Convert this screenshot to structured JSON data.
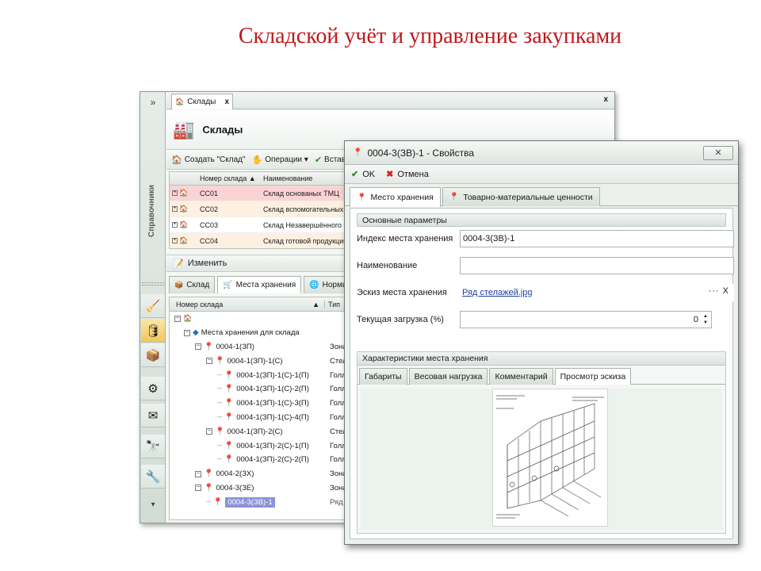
{
  "slide": {
    "title": "Складской учёт и управление закупками"
  },
  "back_window": {
    "sidebar": {
      "collapse_glyph": "»",
      "vertical_label": "Справочники",
      "more_glyph": "▾"
    },
    "doc_tab": {
      "label": "Склады",
      "close": "x"
    },
    "window_close": "x",
    "header": {
      "title": "Склады"
    },
    "toolbar": {
      "create": "Создать \"Склад\"",
      "operations": "Операции ▾",
      "insert": "Вставт"
    },
    "grid": {
      "columns": [
        "Номер склада ▲",
        "Наименование"
      ],
      "rows": [
        {
          "code": "СС01",
          "name": "Склад основаных ТМЦ"
        },
        {
          "code": "СС02",
          "name": "Склад вспомогательных"
        },
        {
          "code": "СС03",
          "name": "Склад Незавершённого п"
        },
        {
          "code": "СС04",
          "name": "Склад готовой продукции"
        }
      ]
    },
    "edit_label": "Изменить",
    "subtabs": [
      "Склад",
      "Места хранения",
      "Нормы за"
    ],
    "tree": {
      "columns": [
        "Номер склада",
        "▲",
        "Тип"
      ],
      "root_label": "Места хранения для склада",
      "rows": [
        {
          "label": "0004-1(ЗП)",
          "type": "Зона",
          "level": 2
        },
        {
          "label": "0004-1(ЗП)-1(С)",
          "type": "Стел",
          "level": 3
        },
        {
          "label": "0004-1(ЗП)-1(С)-1(П)",
          "type": "Голл",
          "level": 4
        },
        {
          "label": "0004-1(ЗП)-1(С)-2(П)",
          "type": "Голл",
          "level": 4
        },
        {
          "label": "0004-1(ЗП)-1(С)-3(П)",
          "type": "Голл",
          "level": 4
        },
        {
          "label": "0004-1(ЗП)-1(С)-4(П)",
          "type": "Голл",
          "level": 4
        },
        {
          "label": "0004-1(ЗП)-2(С)",
          "type": "Стел",
          "level": 3
        },
        {
          "label": "0004-1(ЗП)-2(С)-1(П)",
          "type": "Голл",
          "level": 4
        },
        {
          "label": "0004-1(ЗП)-2(С)-2(П)",
          "type": "Голл",
          "level": 4
        },
        {
          "label": "0004-2(ЗХ)",
          "type": "Зона",
          "level": 2
        },
        {
          "label": "0004-3(ЗЕ)",
          "type": "Зона",
          "level": 2
        },
        {
          "label": "0004-3(ЗВ)-1",
          "type": "Ряд",
          "level": 3
        }
      ]
    }
  },
  "dialog": {
    "title": "0004-3(ЗВ)-1 - Свойства",
    "close_glyph": "✕",
    "ok": "OK",
    "cancel": "Отмена",
    "tabs": [
      "Место хранения",
      "Товарно-материальные ценности"
    ],
    "basic_group": "Основные параметры",
    "fields": {
      "index_label": "Индекс места хранения",
      "index_value": "0004-3(ЗВ)-1",
      "name_label": "Наименование",
      "name_value": "",
      "sketch_label": "Эскиз места хранения",
      "sketch_value": "Ряд стелажей.jpg",
      "sketch_tail": "··· X",
      "load_label": "Текущая загрузка (%)",
      "load_value": "0"
    },
    "char_group": "Характеристики места хранения",
    "inner_tabs": [
      "Габариты",
      "Весовая нагрузка",
      "Комментарий",
      "Просмотр эскиза"
    ]
  }
}
